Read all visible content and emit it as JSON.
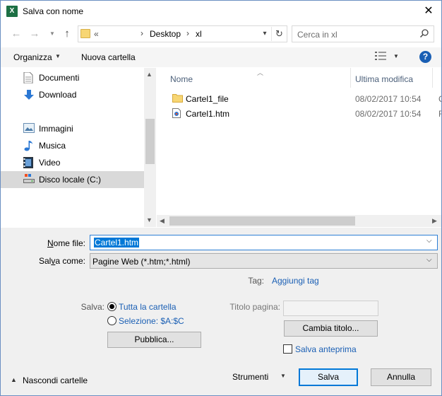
{
  "window": {
    "title": "Salva con nome",
    "app_icon": "excel-icon"
  },
  "nav": {
    "address": {
      "overflow": "«",
      "crumbs": [
        "Desktop",
        "xl"
      ]
    },
    "search_placeholder": "Cerca in xl"
  },
  "toolbar": {
    "organize": "Organizza",
    "new_folder": "Nuova cartella",
    "help": "?"
  },
  "sidebar": {
    "items": [
      {
        "label": "Documenti",
        "icon": "documents-icon"
      },
      {
        "label": "Download",
        "icon": "download-icon"
      },
      {
        "label": "Immagini",
        "icon": "pictures-icon"
      },
      {
        "label": "Musica",
        "icon": "music-icon"
      },
      {
        "label": "Video",
        "icon": "video-icon"
      },
      {
        "label": "Disco locale (C:)",
        "icon": "drive-icon",
        "selected": true
      }
    ]
  },
  "files": {
    "columns": {
      "name": "Nome",
      "modified": "Ultima modifica"
    },
    "rows": [
      {
        "name": "Cartel1_file",
        "modified": "08/02/2017 10:54",
        "extra": "C",
        "icon": "folder-icon"
      },
      {
        "name": "Cartel1.htm",
        "modified": "08/02/2017 10:54",
        "extra": "F",
        "icon": "web-file-icon"
      }
    ]
  },
  "form": {
    "filename_label": "Nome file:",
    "filename_value": "Cartel1.htm",
    "type_label": "Salva come:",
    "type_value": "Pagine Web (*.htm;*.html)",
    "tag_label": "Tag:",
    "tag_link": "Aggiungi tag",
    "save_label": "Salva:",
    "radio_all": "Tutta la cartella",
    "radio_selection": "Selezione: $A:$C",
    "publish_button": "Pubblica...",
    "page_title_label": "Titolo pagina:",
    "page_title_value": "",
    "change_title_button": "Cambia titolo...",
    "preview_label": "Salva anteprima"
  },
  "footer": {
    "hide_folders": "Nascondi cartelle",
    "tools": "Strumenti",
    "save_button": "Salva",
    "cancel_button": "Annulla"
  },
  "colors": {
    "accent": "#0078d7",
    "link": "#1a5fb4",
    "panel": "#f0f0f0",
    "selected_nav": "#d9d9d9"
  }
}
